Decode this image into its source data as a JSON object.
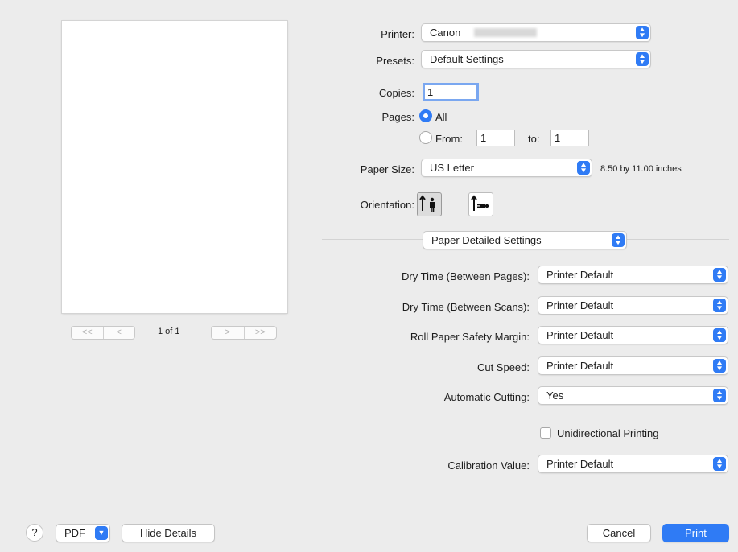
{
  "preview": {
    "page_indicator": "1 of 1",
    "first": "<<",
    "prev": "<",
    "next": ">",
    "last": ">>"
  },
  "printer": {
    "label": "Printer:",
    "value": "Canon"
  },
  "presets": {
    "label": "Presets:",
    "value": "Default Settings"
  },
  "copies": {
    "label": "Copies:",
    "value": "1"
  },
  "pages": {
    "label": "Pages:",
    "all_label": "All",
    "from_label": "From:",
    "from_value": "1",
    "to_label": "to:",
    "to_value": "1",
    "selected": "All"
  },
  "paper_size": {
    "label": "Paper Size:",
    "value": "US Letter",
    "dimensions": "8.50 by 11.00 inches"
  },
  "orientation": {
    "label": "Orientation:",
    "selected": "portrait"
  },
  "section": {
    "value": "Paper Detailed Settings"
  },
  "settings": [
    {
      "label": "Dry Time (Between Pages):",
      "value": "Printer Default"
    },
    {
      "label": "Dry Time (Between Scans):",
      "value": "Printer Default"
    },
    {
      "label": "Roll Paper Safety Margin:",
      "value": "Printer Default"
    },
    {
      "label": "Cut Speed:",
      "value": "Printer Default"
    },
    {
      "label": "Automatic Cutting:",
      "value": "Yes"
    }
  ],
  "unidirectional": {
    "label": "Unidirectional Printing",
    "checked": false
  },
  "calibration": {
    "label": "Calibration Value:",
    "value": "Printer Default"
  },
  "footer": {
    "help": "?",
    "pdf": "PDF",
    "hide_details": "Hide Details",
    "cancel": "Cancel",
    "print": "Print"
  },
  "colors": {
    "accent": "#2f7bf5",
    "background": "#ececec"
  }
}
